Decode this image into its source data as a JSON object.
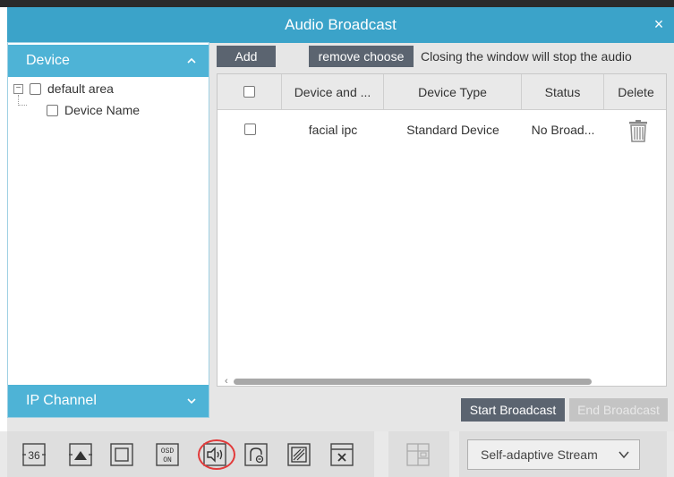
{
  "window": {
    "title": "Audio Broadcast",
    "close_glyph": "×"
  },
  "left_panel": {
    "device_header": "Device",
    "ip_channel_header": "IP Channel",
    "tree": {
      "root_label": "default area",
      "expander_glyph": "⊟",
      "child_label": "Device Name"
    }
  },
  "toolbar": {
    "add_label": "Add",
    "remove_label": "remove choose",
    "note": "Closing the window will stop the audio"
  },
  "table": {
    "columns": [
      "Device and ...",
      "Device Type",
      "Status",
      "Delete"
    ],
    "rows": [
      {
        "name": "facial ipc",
        "type": "Standard Device",
        "status": "No Broad...",
        "delete_icon": "trash-icon"
      }
    ]
  },
  "actions": {
    "start_label": "Start Broadcast",
    "end_label": "End Broadcast"
  },
  "bottom_toolbar": {
    "icons": [
      "36-icon",
      "up-arrow-icon",
      "fullscreen-icon",
      "osd-on-icon",
      "audio-broadcast-icon",
      "record-icon",
      "snapshot-icon",
      "close-window-icon",
      "layout-icon"
    ],
    "label_36": "36",
    "osd_top": "OSD",
    "osd_bottom": "ON",
    "stream_value": "Self-adaptive Stream"
  },
  "colors": {
    "title_bar": "#3ba3c9",
    "accordion_header": "#4eb3d6",
    "dark_button": "#5b6470",
    "highlight_ring": "#e23a3a"
  }
}
